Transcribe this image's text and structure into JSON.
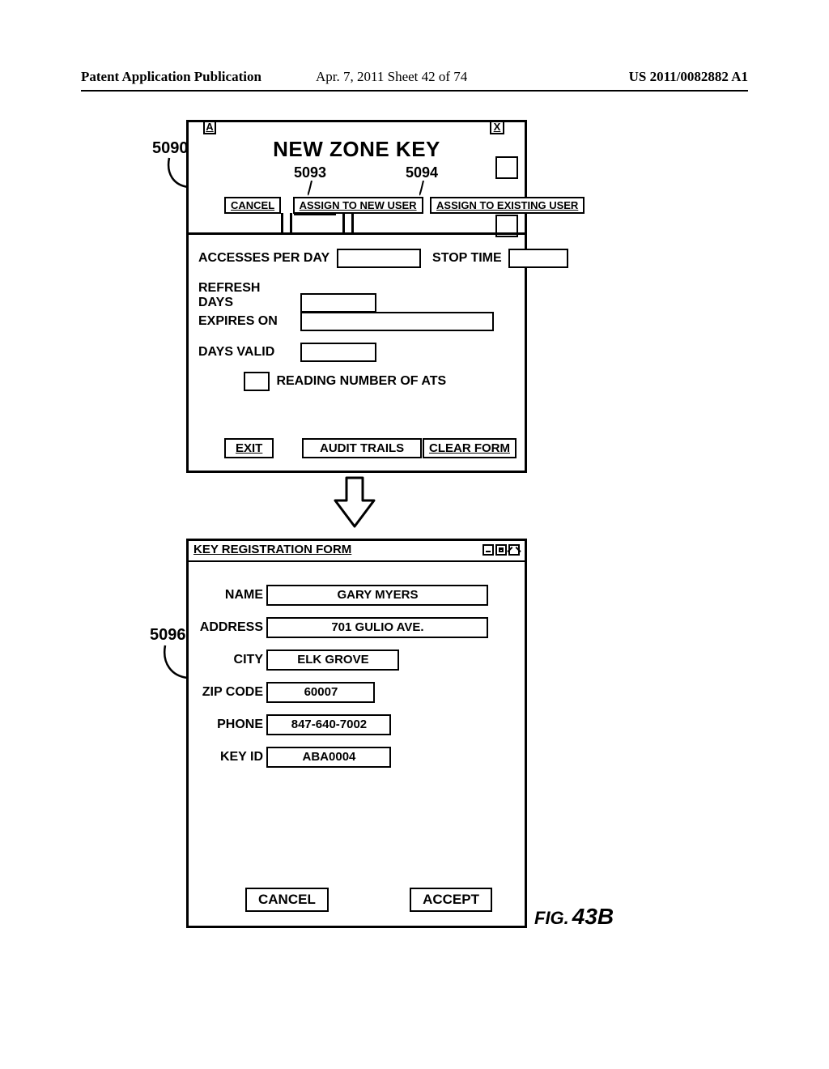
{
  "header": {
    "left": "Patent Application Publication",
    "mid": "Apr. 7, 2011  Sheet 42 of 74",
    "right": "US 2011/0082882 A1"
  },
  "refs": {
    "r5090": "5090",
    "r5093": "5093",
    "r5094": "5094",
    "r5096": "5096"
  },
  "win1": {
    "titlebar": {
      "A": "A",
      "X": "X"
    },
    "title": "NEW ZONE KEY",
    "buttons": {
      "cancel": "CANCEL",
      "assign_new": "ASSIGN TO NEW USER",
      "assign_existing": "ASSIGN TO EXISTING USER",
      "exit": "EXIT",
      "audit": "AUDIT TRAILS",
      "clear": "CLEAR FORM"
    },
    "labels": {
      "accesses": "ACCESSES PER DAY",
      "stop_time": "STOP TIME",
      "refresh": "REFRESH DAYS",
      "expires": "EXPIRES ON",
      "days_valid": "DAYS VALID",
      "reading_ats": "READING NUMBER OF ATS"
    }
  },
  "win2": {
    "title": "KEY REGISTRATION FORM",
    "labels": {
      "name": "NAME",
      "address": "ADDRESS",
      "city": "CITY",
      "zip": "ZIP CODE",
      "phone": "PHONE",
      "key_id": "KEY ID"
    },
    "values": {
      "name": "GARY MYERS",
      "address": "701 GULIO AVE.",
      "city": "ELK GROVE",
      "zip": "60007",
      "phone": "847-640-7002",
      "key_id": "ABA0004"
    },
    "buttons": {
      "cancel": "CANCEL",
      "accept": "ACCEPT"
    }
  },
  "figure": {
    "prefix": "FIG.",
    "num": "43B"
  }
}
